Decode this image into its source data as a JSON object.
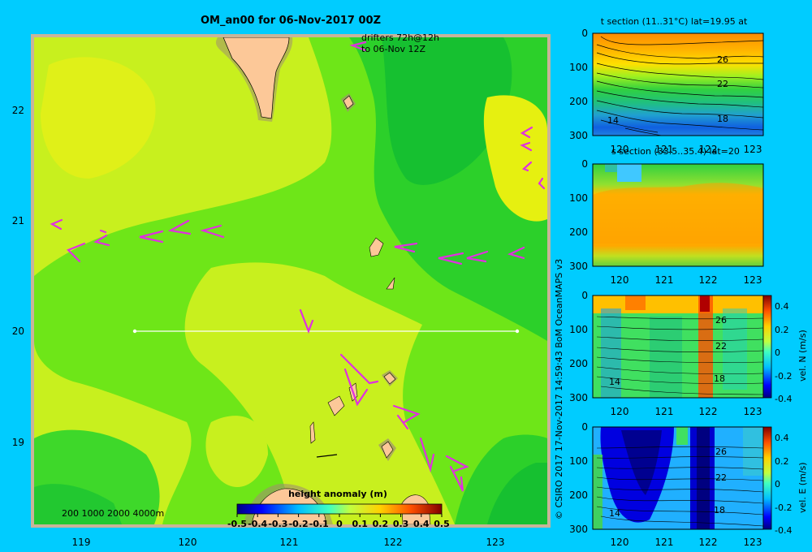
{
  "main_map": {
    "title": "OM_an00 for 06-Nov-2017 00Z",
    "drifters_note_line1": "drifters 72h@12h",
    "drifters_note_line2": "to 06-Nov 12Z",
    "depth_legend": "200  1000  2000  4000m",
    "x_ticks": [
      "119",
      "120",
      "121",
      "122",
      "123"
    ],
    "y_ticks": [
      "22",
      "21",
      "20",
      "19"
    ],
    "section_line": {
      "lat": 20,
      "lon_start": 119.5,
      "lon_end": 123.2
    }
  },
  "colorbar": {
    "title": "height anomaly  (m)",
    "ticks": [
      "-0.5",
      "-0.4",
      "-0.3",
      "-0.2",
      "-0.1",
      "0",
      "0.1",
      "0.2",
      "0.3",
      "0.4",
      "0.5"
    ]
  },
  "copyright": "© CSIRO 2017   17-Nov-2017 14:59:43 BoM OceanMAPS v3",
  "panels": {
    "t_section": {
      "title": "t section (11..31°C) lat=19.95 at",
      "x_ticks": [
        "120",
        "121",
        "122",
        "123"
      ],
      "y_ticks": [
        "0",
        "100",
        "200",
        "300"
      ],
      "contour_labels": [
        "26",
        "22",
        "18",
        "14"
      ]
    },
    "s_section": {
      "title": "s section (33.5..35.4) lat=20",
      "x_ticks": [
        "120",
        "121",
        "122",
        "123"
      ],
      "y_ticks": [
        "0",
        "100",
        "200",
        "300"
      ]
    },
    "vn_section": {
      "x_ticks": [
        "120",
        "121",
        "122",
        "123"
      ],
      "y_ticks": [
        "0",
        "100",
        "200",
        "300"
      ],
      "contour_labels": [
        "26",
        "22",
        "18",
        "14"
      ],
      "cb_label": "vel. N (m/s)",
      "cb_ticks": [
        "0.4",
        "0.2",
        "0",
        "-0.2",
        "-0.4"
      ]
    },
    "ve_section": {
      "x_ticks": [
        "120",
        "121",
        "122",
        "123"
      ],
      "y_ticks": [
        "0",
        "100",
        "200",
        "300"
      ],
      "contour_labels": [
        "26",
        "22",
        "18",
        "14"
      ],
      "cb_label": "vel. E (m/s)",
      "cb_ticks": [
        "0.4",
        "0.2",
        "0",
        "-0.2",
        "-0.4"
      ]
    }
  },
  "chart_data": [
    {
      "type": "heatmap",
      "title": "OM_an00 for 06-Nov-2017 00Z",
      "xlabel": "",
      "ylabel": "",
      "xlim": [
        118.5,
        123.5
      ],
      "ylim": [
        18.3,
        22.7
      ],
      "colorbar_label": "height anomaly  (m)",
      "colorbar_range": [
        -0.5,
        0.5
      ]
    },
    {
      "type": "heatmap",
      "title": "t section (11..31°C) lat=19.95 at",
      "xlim": [
        119.5,
        123.2
      ],
      "ylim": [
        300,
        0
      ]
    },
    {
      "type": "heatmap",
      "title": "s section (33.5..35.4) lat=20",
      "xlim": [
        119.5,
        123.2
      ],
      "ylim": [
        300,
        0
      ]
    },
    {
      "type": "heatmap",
      "xlim": [
        119.5,
        123.2
      ],
      "ylim": [
        300,
        0
      ],
      "colorbar_label": "vel. N (m/s)",
      "colorbar_range": [
        -0.4,
        0.4
      ]
    },
    {
      "type": "heatmap",
      "xlim": [
        119.5,
        123.2
      ],
      "ylim": [
        300,
        0
      ],
      "colorbar_label": "vel. E (m/s)",
      "colorbar_range": [
        -0.4,
        0.4
      ]
    }
  ]
}
